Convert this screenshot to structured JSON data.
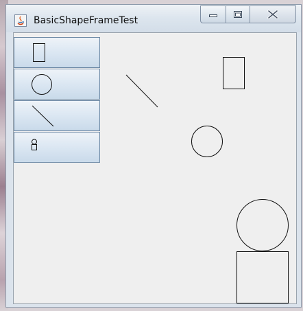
{
  "window": {
    "title": "BasicShapeFrameTest",
    "app_icon": "java-icon",
    "controls": {
      "minimize": "minimize-icon",
      "maximize": "maximize-icon",
      "close": "close-icon"
    }
  },
  "toolbar": {
    "buttons": [
      {
        "name": "rectangle-tool-button",
        "icon": "rectangle-icon"
      },
      {
        "name": "circle-tool-button",
        "icon": "circle-icon"
      },
      {
        "name": "line-tool-button",
        "icon": "line-icon"
      },
      {
        "name": "composite-tool-button",
        "icon": "composite-shape-icon"
      }
    ]
  },
  "canvas": {
    "shapes": [
      "line",
      "rectangle",
      "circle",
      "circle",
      "rectangle"
    ]
  }
}
